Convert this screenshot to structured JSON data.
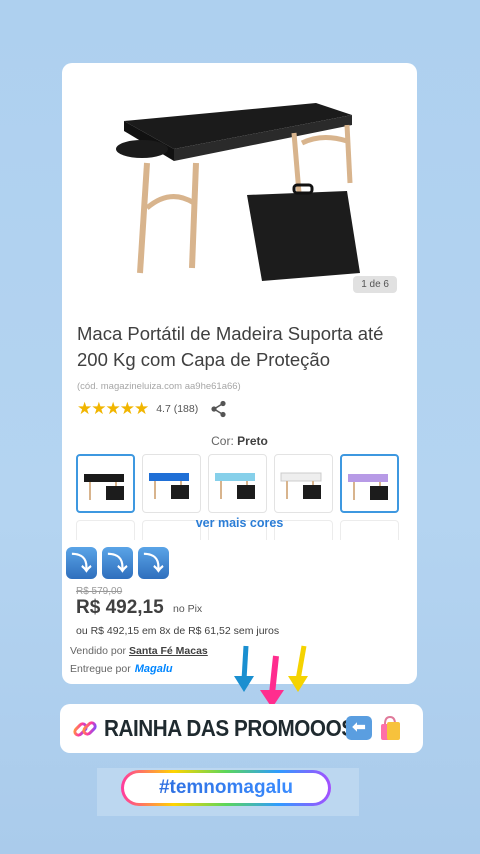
{
  "product": {
    "image_counter": "1 de 6",
    "title": "Maca Portátil de Madeira Suporta até 200 Kg com Capa de Proteção",
    "code": "(cód. magazineluiza.com aa9he61a66)",
    "rating_value": "4.7 (188)",
    "stars": "★★★★★",
    "color_label": "Cor:",
    "color_value": "Preto",
    "swatch_colors": [
      "#1a1a1a",
      "#1f6fd6",
      "#86d0ea",
      "#eeeeee",
      "#b79ae6"
    ],
    "more_colors": "ver mais cores",
    "old_price": "R$ 579,00",
    "price": "R$ 492,15",
    "price_suffix": "no Pix",
    "installments": "ou R$ 492,15 em 8x de R$ 61,52 sem juros",
    "seller_label": "Vendido por",
    "seller_name": "Santa Fé Macas",
    "delivery_label": "Entregue por",
    "delivery_brand": "Magalu"
  },
  "overlay": {
    "down_arrows": [
      "⤵",
      "⤵",
      "⤵"
    ],
    "banner_text": "RAINHA DAS PROMOOOS",
    "hashtag": "#temnomagalu",
    "pointer_colors": [
      "#1a8fd0",
      "#ff2d8e",
      "#f5d300"
    ]
  },
  "icons": [
    "share-icon",
    "link-icon",
    "shopping-bag-icon",
    "left-arrow-icon",
    "down-arrow-icon"
  ]
}
